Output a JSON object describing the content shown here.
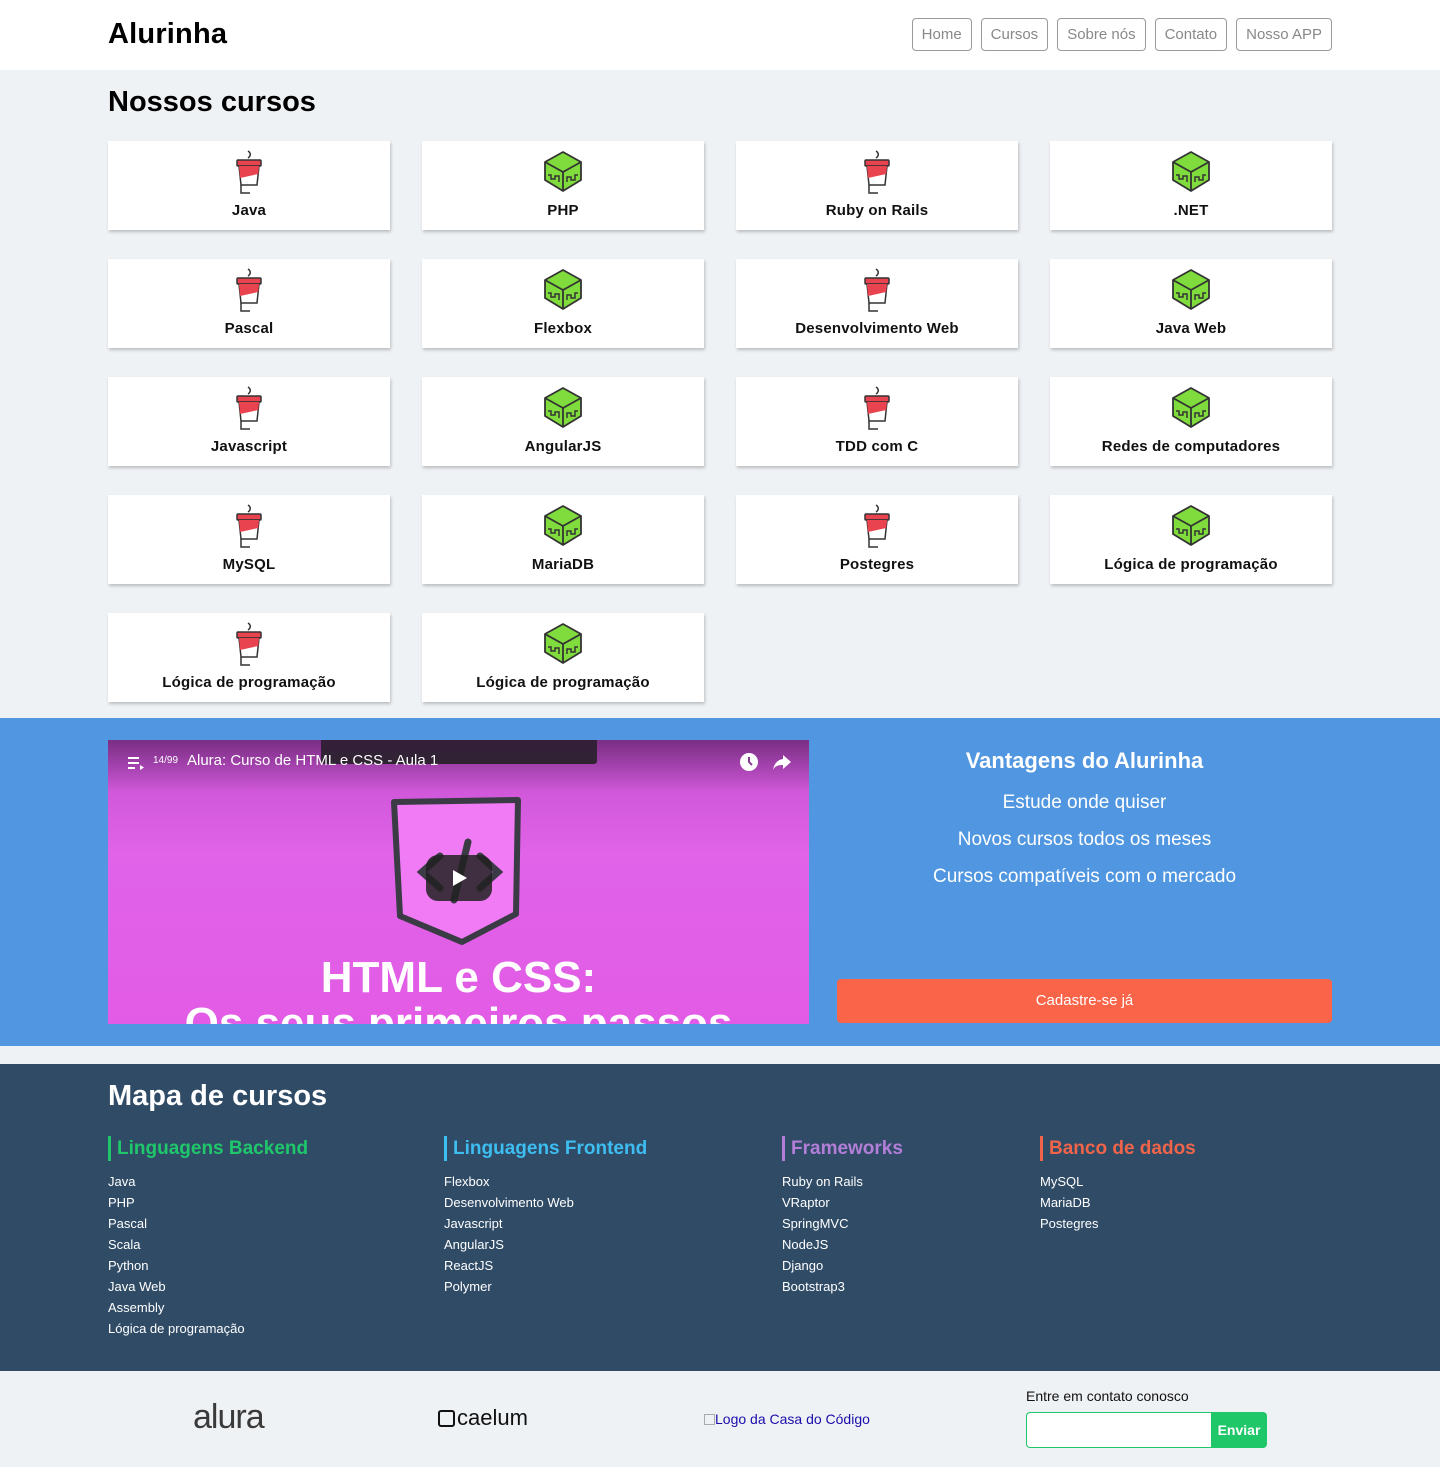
{
  "header": {
    "logo": "Alurinha",
    "nav": [
      "Home",
      "Cursos",
      "Sobre nós",
      "Contato",
      "Nosso APP"
    ]
  },
  "courses": {
    "title": "Nossos cursos",
    "items": [
      {
        "name": "Java",
        "icon": "cup-icon"
      },
      {
        "name": "PHP",
        "icon": "cube-icon"
      },
      {
        "name": "Ruby on Rails",
        "icon": "cup-icon"
      },
      {
        "name": ".NET",
        "icon": "cube-icon"
      },
      {
        "name": "Pascal",
        "icon": "cup-icon"
      },
      {
        "name": "Flexbox",
        "icon": "cube-icon"
      },
      {
        "name": "Desenvolvimento Web",
        "icon": "cup-icon"
      },
      {
        "name": "Java Web",
        "icon": "cube-icon"
      },
      {
        "name": "Javascript",
        "icon": "cup-icon"
      },
      {
        "name": "AngularJS",
        "icon": "cube-icon"
      },
      {
        "name": "TDD com C",
        "icon": "cup-icon"
      },
      {
        "name": "Redes de computadores",
        "icon": "cube-icon"
      },
      {
        "name": "MySQL",
        "icon": "cup-icon"
      },
      {
        "name": "MariaDB",
        "icon": "cube-icon"
      },
      {
        "name": "Postegres",
        "icon": "cup-icon"
      },
      {
        "name": "Lógica de programação",
        "icon": "cube-icon"
      },
      {
        "name": "Lógica de programação",
        "icon": "cup-icon"
      },
      {
        "name": "Lógica de programação",
        "icon": "cube-icon"
      }
    ]
  },
  "video": {
    "counter": "14/99",
    "title": "Alura: Curso de HTML e CSS - Aula 1",
    "line1": "HTML e CSS:",
    "line2": "Os seus primeiros passos"
  },
  "advantages": {
    "title": "Vantagens do Alurinha",
    "items": [
      "Estude onde quiser",
      "Novos cursos todos os meses",
      "Cursos compatíveis com o mercado"
    ],
    "cta": "Cadastre-se já"
  },
  "map": {
    "title": "Mapa de cursos",
    "columns": [
      {
        "heading": "Linguagens Backend",
        "color": "#1fc76a",
        "items": [
          "Java",
          "PHP",
          "Pascal",
          "Scala",
          "Python",
          "Java Web",
          "Assembly",
          "Lógica de programação"
        ]
      },
      {
        "heading": "Linguagens Frontend",
        "color": "#3dbdf0",
        "items": [
          "Flexbox",
          "Desenvolvimento Web",
          "Javascript",
          "AngularJS",
          "ReactJS",
          "Polymer"
        ]
      },
      {
        "heading": "Frameworks",
        "color": "#b27ed8",
        "items": [
          "Ruby on Rails",
          "VRaptor",
          "SpringMVC",
          "NodeJS",
          "Django",
          "Bootstrap3"
        ]
      },
      {
        "heading": "Banco de dados",
        "color": "#f0644a",
        "items": [
          "MySQL",
          "MariaDB",
          "Postegres"
        ]
      }
    ]
  },
  "footer": {
    "alura": "alura",
    "caelum": "caelum",
    "casa_do_codigo_alt": "Logo da Casa do Código",
    "contact_label": "Entre em contato conosco",
    "send": "Enviar"
  },
  "colors": {
    "brand_blue": "#5096e0",
    "cta_orange": "#fa6448",
    "map_bg": "#2f4b66",
    "send_green": "#1fc769"
  }
}
